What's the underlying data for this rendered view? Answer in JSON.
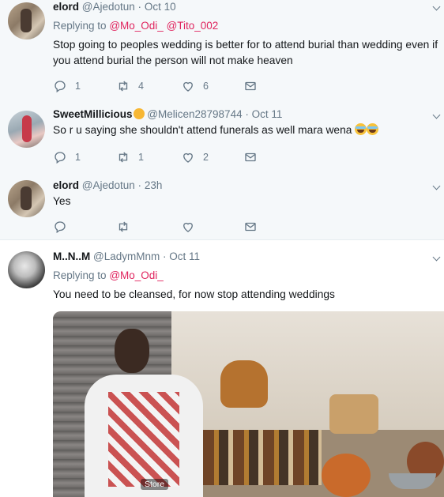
{
  "tweets": [
    {
      "name": "elord",
      "handle": "@Ajedotun",
      "time": "Oct 10",
      "reply_prefix": "Replying to",
      "reply_mentions": [
        "@Mo_Odi_",
        "@Tito_002"
      ],
      "text": "Stop going to peoples wedding is better for to attend burial than wedding even if you attend burial the person will not make heaven",
      "replies": "1",
      "retweets": "4",
      "likes": "6"
    },
    {
      "name": "SweetMillicious",
      "handle": "@Melicen28798744",
      "time": "Oct 11",
      "text": "So r u saying she shouldn't attend funerals as well mara wena",
      "replies": "1",
      "retweets": "1",
      "likes": "2"
    },
    {
      "name": "elord",
      "handle": "@Ajedotun",
      "time": "23h",
      "text": "Yes"
    },
    {
      "name": "M..N..M",
      "handle": "@LadymMnm",
      "time": "Oct 11",
      "reply_prefix": "Replying to",
      "reply_mentions": [
        "@Mo_Odi_"
      ],
      "text": "You need to be cleansed, for now stop attending weddings",
      "media_label": "Store"
    }
  ],
  "separator": "·",
  "icons": [
    "reply-icon",
    "retweet-icon",
    "like-icon",
    "direct-message-icon",
    "chevron-down-icon"
  ],
  "colors": {
    "mention": "#e0245e",
    "thread_line": "#e1a6b4",
    "muted": "#657786",
    "highlight_bg": "#f5f8fa"
  }
}
